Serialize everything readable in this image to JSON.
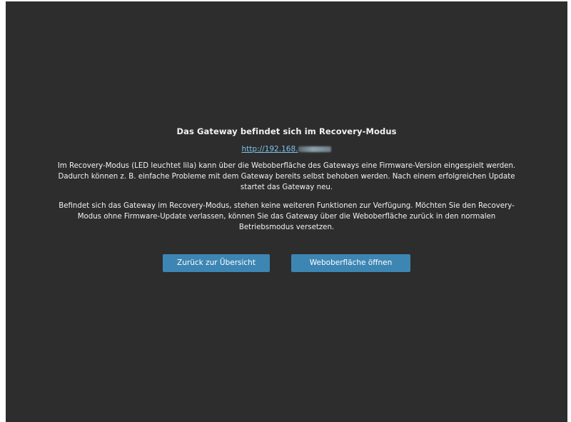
{
  "dialog": {
    "title": "Das Gateway befindet sich im Recovery-Modus",
    "link_text": "http://192.168.",
    "paragraph1": "Im Recovery-Modus (LED leuchtet lila) kann über die Weboberfläche des Gateways eine Firmware-Version eingespielt werden. Dadurch können z. B. einfache Probleme mit dem Gateway bereits selbst behoben werden. Nach einem erfolgreichen Update startet das Gateway neu.",
    "paragraph2": "Befindet sich das Gateway im Recovery-Modus, stehen keine weiteren Funktionen zur Verfügung. Möchten Sie den Recovery-Modus ohne Firmware-Update verlassen, können Sie das Gateway über die Weboberfläche zurück in den normalen Betriebsmodus versetzen."
  },
  "buttons": {
    "back_label": "Zurück zur Übersicht",
    "open_label": "Weboberfläche öffnen"
  },
  "colors": {
    "background": "#2d2d2d",
    "text": "#f2f2f2",
    "link": "#7fc2ea",
    "button": "#3d86b3"
  }
}
